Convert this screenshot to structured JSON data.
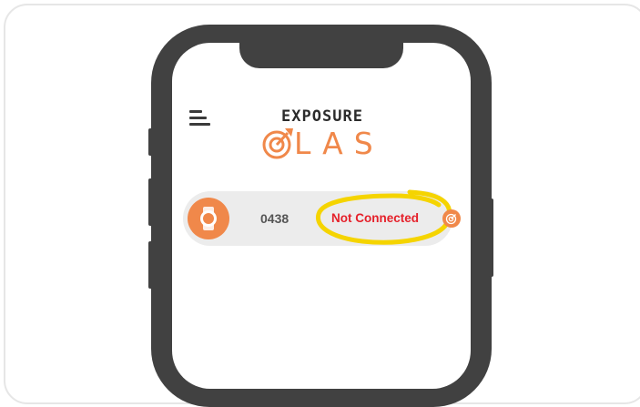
{
  "app": {
    "logo_line1": "EXPOSURE",
    "logo_line2": "LAS"
  },
  "device": {
    "id": "0438",
    "status": "Not Connected"
  },
  "colors": {
    "accent": "#f0884a",
    "status_error": "#e5202a",
    "highlight": "#f5d400",
    "phone_frame": "#414141"
  },
  "icons": {
    "menu": "hamburger-menu-icon",
    "logo_mark": "target-arrow-icon",
    "device": "watch-icon",
    "status_badge": "target-arrow-icon"
  }
}
